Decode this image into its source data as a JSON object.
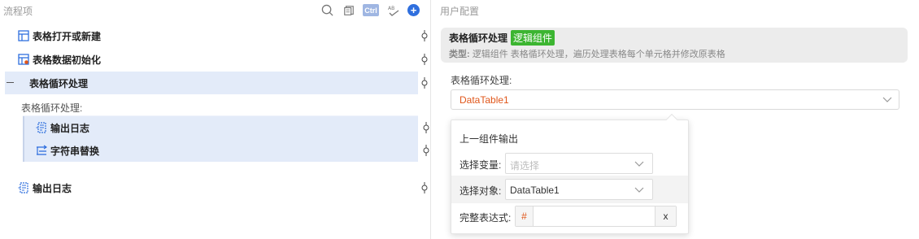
{
  "left": {
    "title": "流程项",
    "toolbar": {
      "ctrl_label": "Ctrl",
      "plus_label": "+"
    },
    "items": [
      {
        "label": "表格打开或新建",
        "icon": "table-icon"
      },
      {
        "label": "表格数据初始化",
        "icon": "table-init-icon"
      },
      {
        "label": "表格循环处理",
        "icon": "loop-dash"
      },
      {
        "label": "输出日志",
        "icon": "log-icon"
      },
      {
        "label": "字符串替换",
        "icon": "replace-icon"
      },
      {
        "label": "输出日志",
        "icon": "log-icon"
      }
    ],
    "sub_label": "表格循环处理:"
  },
  "right": {
    "title": "用户配置",
    "card": {
      "title": "表格循环处理",
      "badge": "逻辑组件",
      "desc_prefix": "类型:",
      "desc_text": "逻辑组件 表格循环处理，遍历处理表格每个单元格并修改原表格"
    },
    "field_label": "表格循环处理:",
    "field_value": "DataTable1",
    "popup": {
      "title": "上一组件输出",
      "var_label": "选择变量:",
      "var_placeholder": "请选择",
      "obj_label": "选择对象:",
      "obj_value": "DataTable1",
      "expr_label": "完整表达式:",
      "expr_prefix": "#",
      "expr_clear": "x"
    }
  },
  "colors": {
    "accent": "#2f6fde",
    "badge": "#3cb531",
    "value": "#e0561a",
    "row_highlight": "#e3ebf9"
  }
}
